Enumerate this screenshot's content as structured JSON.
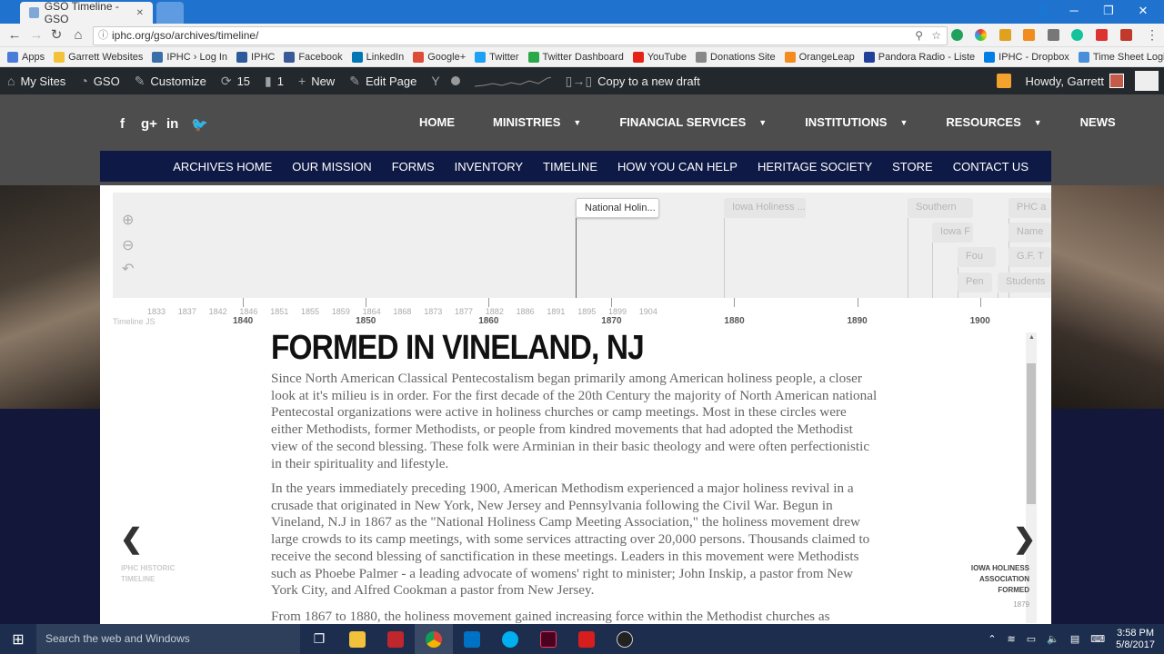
{
  "browser": {
    "tab_title": "GSO Timeline - GSO",
    "tab_close": "✕",
    "url": "iphc.org/gso/archives/timeline/",
    "bookmarks": [
      {
        "label": "Apps",
        "color": "#4a7bd6"
      },
      {
        "label": "Garrett Websites",
        "color": "#f2c23a"
      },
      {
        "label": "IPHC › Log In",
        "color": "#3a6ea8"
      },
      {
        "label": "IPHC",
        "color": "#2d5a9b"
      },
      {
        "label": "Facebook",
        "color": "#3b5998"
      },
      {
        "label": "LinkedIn",
        "color": "#0077b5"
      },
      {
        "label": "Google+",
        "color": "#dd4b39"
      },
      {
        "label": "Twitter",
        "color": "#1da1f2"
      },
      {
        "label": "Twitter Dashboard",
        "color": "#2ba84a"
      },
      {
        "label": "YouTube",
        "color": "#e62117"
      },
      {
        "label": "Donations Site",
        "color": "#888888"
      },
      {
        "label": "OrangeLeap",
        "color": "#f28c1e"
      },
      {
        "label": "Pandora Radio - Liste",
        "color": "#224099"
      },
      {
        "label": "IPHC - Dropbox",
        "color": "#007ee5"
      },
      {
        "label": "Time Sheet Login",
        "color": "#4a90d9"
      }
    ]
  },
  "wp_admin": {
    "my_sites": "My Sites",
    "site": "GSO",
    "customize": "Customize",
    "updates": "15",
    "comments": "1",
    "new": "New",
    "edit_page": "Edit Page",
    "copy_draft": "Copy to a new draft",
    "howdy": "Howdy, Garrett"
  },
  "site_nav": {
    "social": [
      "f",
      "g+",
      "in",
      "🐦"
    ],
    "main": [
      {
        "label": "HOME",
        "dropdown": false
      },
      {
        "label": "MINISTRIES",
        "dropdown": true
      },
      {
        "label": "FINANCIAL SERVICES",
        "dropdown": true
      },
      {
        "label": "INSTITUTIONS",
        "dropdown": true
      },
      {
        "label": "RESOURCES",
        "dropdown": true
      },
      {
        "label": "NEWS",
        "dropdown": false
      }
    ],
    "sub": [
      "ARCHIVES HOME",
      "OUR MISSION",
      "FORMS",
      "INVENTORY",
      "TIMELINE",
      "HOW YOU CAN HELP",
      "HERITAGE SOCIETY",
      "STORE",
      "CONTACT US"
    ]
  },
  "timeline": {
    "credit": "Timeline JS",
    "markers": [
      {
        "label": "National Holin...",
        "active": true
      },
      {
        "label": "Iowa Holiness ...",
        "active": false
      },
      {
        "label": "Southern",
        "active": false
      },
      {
        "label": "PHC a",
        "active": false
      },
      {
        "label": "Iowa F",
        "active": false
      },
      {
        "label": "Name",
        "active": false
      },
      {
        "label": "Fou",
        "active": false
      },
      {
        "label": "G.F. T",
        "active": false
      },
      {
        "label": "Pen",
        "active": false
      },
      {
        "label": "Students",
        "active": false
      }
    ],
    "minor_ticks": [
      "1833",
      "1837",
      "1842",
      "1846",
      "1851",
      "1855",
      "1859",
      "1864",
      "1868",
      "1873",
      "1877",
      "1882",
      "1886",
      "1891",
      "1895",
      "1899",
      "1904"
    ],
    "major_ticks": [
      "1840",
      "1850",
      "1860",
      "1870",
      "1880",
      "1890",
      "1900"
    ],
    "slide": {
      "title": "FORMED IN VINELAND, NJ",
      "paragraphs": [
        "Since North American Classical Pentecostalism began primarily among American holiness people, a closer look at it's milieu is in order. For the first decade of the 20th Century the majority of North American national Pentecostal organizations were active in holiness churches or camp meetings. Most in these circles were either Methodists, former Methodists, or people from kindred movements that had adopted the Methodist view of the second blessing. These folk were Arminian in their basic theology and were often perfectionistic in their spirituality and lifestyle.",
        "In the years immediately preceding 1900, American Methodism experienced a major holiness revival in a crusade that originated in New York, New Jersey and Pennsylvania following the Civil War. Begun in Vineland, N.J in 1867 as the \"National Holiness Camp Meeting Association,\" the holiness movement drew large crowds to its camp meetings, with some services attracting over 20,000 persons. Thousands claimed to receive the second blessing of sanctification in these meetings. Leaders in this movement were Methodists such as Phoebe Palmer - a leading advocate of womens' right to minister; John Inskip, a pastor from New York City, and Alfred Cookman a pastor from New Jersey.",
        "From 1867 to 1880, the holiness movement gained increasing force within the Methodist churches as"
      ]
    },
    "prev": {
      "title": "IPHC HISTORIC TIMELINE",
      "date": ""
    },
    "next": {
      "title": "IOWA HOLINESS ASSOCIATION FORMED",
      "date": "1879"
    }
  },
  "taskbar": {
    "search_placeholder": "Search the web and Windows",
    "time": "3:58 PM",
    "date": "5/8/2017"
  }
}
